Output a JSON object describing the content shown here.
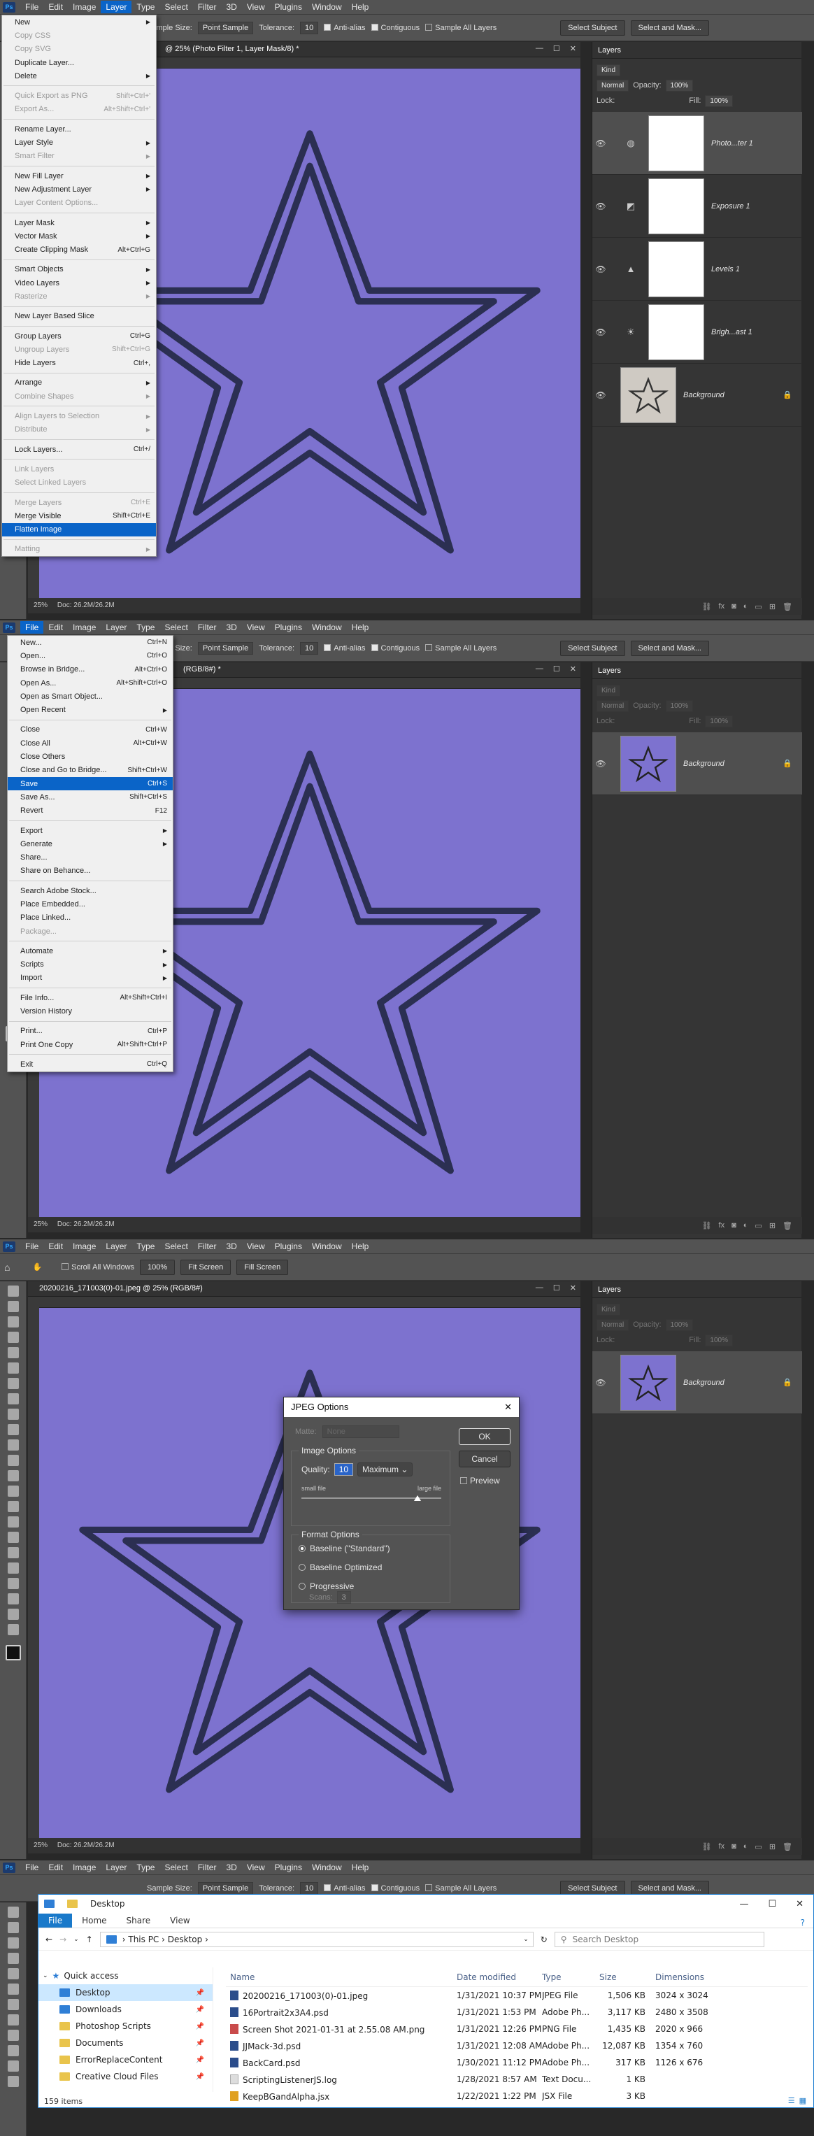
{
  "colors": {
    "canvas": "#7d72cf",
    "ui_bg": "#535353",
    "accent": "#0a64c8"
  },
  "menubar": {
    "items": [
      "File",
      "Edit",
      "Image",
      "Layer",
      "Type",
      "Select",
      "Filter",
      "3D",
      "View",
      "Plugins",
      "Window",
      "Help"
    ]
  },
  "options_bar": {
    "sample_size_label": "Sample Size:",
    "sample_size_value": "Point Sample",
    "tolerance_label": "Tolerance:",
    "tolerance_value": "10",
    "anti_alias": "Anti-alias",
    "contiguous": "Contiguous",
    "sample_all_layers": "Sample All Layers",
    "select_subject": "Select Subject",
    "select_and_mask": "Select and Mask..."
  },
  "hand_options": {
    "scroll_all": "Scroll All Windows",
    "zoom100": "100%",
    "fit_screen": "Fit Screen",
    "fill_screen": "Fill Screen"
  },
  "panel1": {
    "doc_title": "@ 25% (Photo Filter 1, Layer Mask/8) *",
    "zoom": "25%",
    "doc_info": "Doc: 26.2M/26.2M",
    "layers_title": "Layers",
    "kind": "Kind",
    "blend": "Normal",
    "opacity_label": "Opacity:",
    "opacity": "100%",
    "lock_label": "Lock:",
    "fill_label": "Fill:",
    "fill": "100%",
    "layers": [
      {
        "name": "Photo...ter 1",
        "icon": "photo-filter-icon"
      },
      {
        "name": "Exposure 1",
        "icon": "exposure-icon"
      },
      {
        "name": "Levels 1",
        "icon": "levels-icon"
      },
      {
        "name": "Brigh...ast 1",
        "icon": "brightness-icon"
      },
      {
        "name": "Background",
        "icon": "background"
      }
    ],
    "layer_menu": {
      "items": [
        {
          "label": "New",
          "arrow": true
        },
        {
          "label": "Copy CSS",
          "dis": true
        },
        {
          "label": "Copy SVG",
          "dis": true
        },
        {
          "label": "Duplicate Layer..."
        },
        {
          "label": "Delete",
          "arrow": true
        },
        {
          "sep": true
        },
        {
          "label": "Quick Export as PNG",
          "sc": "Shift+Ctrl+'",
          "dis": true
        },
        {
          "label": "Export As...",
          "sc": "Alt+Shift+Ctrl+'",
          "dis": true
        },
        {
          "sep": true
        },
        {
          "label": "Rename Layer..."
        },
        {
          "label": "Layer Style",
          "arrow": true
        },
        {
          "label": "Smart Filter",
          "arrow": true,
          "dis": true
        },
        {
          "sep": true
        },
        {
          "label": "New Fill Layer",
          "arrow": true
        },
        {
          "label": "New Adjustment Layer",
          "arrow": true
        },
        {
          "label": "Layer Content Options...",
          "dis": true
        },
        {
          "sep": true
        },
        {
          "label": "Layer Mask",
          "arrow": true
        },
        {
          "label": "Vector Mask",
          "arrow": true
        },
        {
          "label": "Create Clipping Mask",
          "sc": "Alt+Ctrl+G"
        },
        {
          "sep": true
        },
        {
          "label": "Smart Objects",
          "arrow": true
        },
        {
          "label": "Video Layers",
          "arrow": true
        },
        {
          "label": "Rasterize",
          "arrow": true,
          "dis": true
        },
        {
          "sep": true
        },
        {
          "label": "New Layer Based Slice"
        },
        {
          "sep": true
        },
        {
          "label": "Group Layers",
          "sc": "Ctrl+G"
        },
        {
          "label": "Ungroup Layers",
          "sc": "Shift+Ctrl+G",
          "dis": true
        },
        {
          "label": "Hide Layers",
          "sc": "Ctrl+,"
        },
        {
          "sep": true
        },
        {
          "label": "Arrange",
          "arrow": true
        },
        {
          "label": "Combine Shapes",
          "arrow": true,
          "dis": true
        },
        {
          "sep": true
        },
        {
          "label": "Align Layers to Selection",
          "arrow": true,
          "dis": true
        },
        {
          "label": "Distribute",
          "arrow": true,
          "dis": true
        },
        {
          "sep": true
        },
        {
          "label": "Lock Layers...",
          "sc": "Ctrl+/"
        },
        {
          "sep": true
        },
        {
          "label": "Link Layers",
          "dis": true
        },
        {
          "label": "Select Linked Layers",
          "dis": true
        },
        {
          "sep": true
        },
        {
          "label": "Merge Layers",
          "sc": "Ctrl+E",
          "dis": true
        },
        {
          "label": "Merge Visible",
          "sc": "Shift+Ctrl+E"
        },
        {
          "label": "Flatten Image",
          "hl": true
        },
        {
          "sep": true
        },
        {
          "label": "Matting",
          "arrow": true,
          "dis": true
        }
      ]
    }
  },
  "panel2": {
    "doc_title": "(RGB/8#) *",
    "zoom": "25%",
    "doc_info": "Doc: 26.2M/26.2M",
    "layers_title": "Layers",
    "kind": "Kind",
    "blend": "Normal",
    "opacity_label": "Opacity:",
    "opacity": "100%",
    "lock_label": "Lock:",
    "fill_label": "Fill:",
    "fill": "100%",
    "layer_name": "Background",
    "file_menu": {
      "items": [
        {
          "label": "New...",
          "sc": "Ctrl+N"
        },
        {
          "label": "Open...",
          "sc": "Ctrl+O"
        },
        {
          "label": "Browse in Bridge...",
          "sc": "Alt+Ctrl+O"
        },
        {
          "label": "Open As...",
          "sc": "Alt+Shift+Ctrl+O"
        },
        {
          "label": "Open as Smart Object..."
        },
        {
          "label": "Open Recent",
          "arrow": true
        },
        {
          "sep": true
        },
        {
          "label": "Close",
          "sc": "Ctrl+W"
        },
        {
          "label": "Close All",
          "sc": "Alt+Ctrl+W"
        },
        {
          "label": "Close Others"
        },
        {
          "label": "Close and Go to Bridge...",
          "sc": "Shift+Ctrl+W"
        },
        {
          "label": "Save",
          "sc": "Ctrl+S",
          "hl": true
        },
        {
          "label": "Save As...",
          "sc": "Shift+Ctrl+S"
        },
        {
          "label": "Revert",
          "sc": "F12"
        },
        {
          "sep": true
        },
        {
          "label": "Export",
          "arrow": true
        },
        {
          "label": "Generate",
          "arrow": true
        },
        {
          "label": "Share..."
        },
        {
          "label": "Share on Behance..."
        },
        {
          "sep": true
        },
        {
          "label": "Search Adobe Stock..."
        },
        {
          "label": "Place Embedded..."
        },
        {
          "label": "Place Linked..."
        },
        {
          "label": "Package...",
          "dis": true
        },
        {
          "sep": true
        },
        {
          "label": "Automate",
          "arrow": true
        },
        {
          "label": "Scripts",
          "arrow": true
        },
        {
          "label": "Import",
          "arrow": true
        },
        {
          "sep": true
        },
        {
          "label": "File Info...",
          "sc": "Alt+Shift+Ctrl+I"
        },
        {
          "label": "Version History"
        },
        {
          "sep": true
        },
        {
          "label": "Print...",
          "sc": "Ctrl+P"
        },
        {
          "label": "Print One Copy",
          "sc": "Alt+Shift+Ctrl+P"
        },
        {
          "sep": true
        },
        {
          "label": "Exit",
          "sc": "Ctrl+Q"
        }
      ]
    }
  },
  "panel3": {
    "doc_title": "20200216_171003(0)-01.jpeg @ 25% (RGB/8#)",
    "zoom": "25%",
    "doc_info": "Doc: 26.2M/26.2M",
    "layers_title": "Layers",
    "kind": "Kind",
    "blend": "Normal",
    "opacity_label": "Opacity:",
    "opacity": "100%",
    "lock_label": "Lock:",
    "fill_label": "Fill:",
    "fill": "100%",
    "layer_name": "Background",
    "dialog": {
      "title": "JPEG Options",
      "close": "✕",
      "matte_label": "Matte:",
      "matte_value": "None",
      "image_options": "Image Options",
      "quality_label": "Quality:",
      "quality_value": "10",
      "quality_preset": "Maximum",
      "small_file": "small file",
      "large_file": "large file",
      "quality_fraction": 0.83,
      "format_options": "Format Options",
      "baseline_standard": "Baseline (\"Standard\")",
      "baseline_optimized": "Baseline Optimized",
      "progressive": "Progressive",
      "scans_label": "Scans:",
      "scans_value": "3",
      "ok": "OK",
      "cancel": "Cancel",
      "preview": "Preview"
    }
  },
  "panel4": {
    "explorer": {
      "title": "Desktop",
      "tabs": [
        "File",
        "Home",
        "Share",
        "View"
      ],
      "path": [
        "This PC",
        "Desktop"
      ],
      "search_placeholder": "Search Desktop",
      "nav": [
        {
          "label": "Quick access",
          "color": "blue"
        },
        {
          "label": "Desktop",
          "pin": "📌"
        },
        {
          "label": "Downloads",
          "pin": "📌"
        },
        {
          "label": "Photoshop Scripts",
          "pin": "📌"
        },
        {
          "label": "Documents",
          "pin": "📌"
        },
        {
          "label": "ErrorReplaceContent",
          "pin": "📌"
        },
        {
          "label": "Creative Cloud Files",
          "pin": "📌"
        }
      ],
      "columns": [
        "Name",
        "Date modified",
        "Type",
        "Size",
        "Dimensions"
      ],
      "files": [
        {
          "name": "20200216_171003(0)-01.jpeg",
          "date": "1/31/2021 10:37 PM",
          "type": "JPEG File",
          "size": "1,506 KB",
          "dim": "3024 x 3024"
        },
        {
          "name": "16Portrait2x3A4.psd",
          "date": "1/31/2021 1:53 PM",
          "type": "Adobe Ph...",
          "size": "3,117 KB",
          "dim": "2480 x 3508"
        },
        {
          "name": "Screen Shot 2021-01-31 at 2.55.08 AM.png",
          "date": "1/31/2021 12:26 PM",
          "type": "PNG File",
          "size": "1,435 KB",
          "dim": "2020 x 966"
        },
        {
          "name": "JJMack-3d.psd",
          "date": "1/31/2021 12:08 AM",
          "type": "Adobe Ph...",
          "size": "12,087 KB",
          "dim": "1354 x 760"
        },
        {
          "name": "BackCard.psd",
          "date": "1/30/2021 11:12 PM",
          "type": "Adobe Ph...",
          "size": "317 KB",
          "dim": "1126 x 676"
        },
        {
          "name": "ScriptingListenerJS.log",
          "date": "1/28/2021 8:57 AM",
          "type": "Text Docu...",
          "size": "1 KB",
          "dim": ""
        },
        {
          "name": "KeepBGandAlpha.jsx",
          "date": "1/22/2021 1:22 PM",
          "type": "JSX File",
          "size": "3 KB",
          "dim": ""
        }
      ],
      "item_count": "159 items"
    }
  }
}
